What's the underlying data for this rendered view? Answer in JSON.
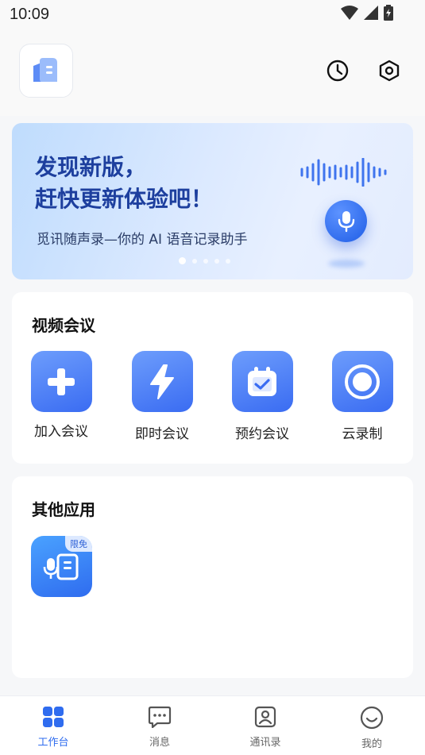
{
  "status_bar": {
    "time": "10:09"
  },
  "header": {
    "logo_icon": "app-logo-icon",
    "history_icon": "clock-icon",
    "settings_icon": "settings-hexagon-icon"
  },
  "banner": {
    "title": "发现新版，\n赶快更新体验吧！",
    "subtitle": "觅讯随声录—你的 AI 语音记录助手",
    "pages": 5,
    "active_page": 1
  },
  "video_meeting": {
    "title": "视频会议",
    "items": [
      {
        "label": "加入会议",
        "icon": "plus-icon"
      },
      {
        "label": "即时会议",
        "icon": "lightning-icon"
      },
      {
        "label": "预约会议",
        "icon": "calendar-check-icon"
      },
      {
        "label": "云录制",
        "icon": "record-icon"
      }
    ]
  },
  "other_apps": {
    "title": "其他应用",
    "apps": [
      {
        "badge": "限免",
        "icon": "voice-recorder-icon"
      }
    ]
  },
  "tabs": [
    {
      "label": "工作台",
      "icon": "grid-icon",
      "active": true
    },
    {
      "label": "消息",
      "icon": "message-icon",
      "active": false
    },
    {
      "label": "通讯录",
      "icon": "contacts-icon",
      "active": false
    },
    {
      "label": "我的",
      "icon": "smile-icon",
      "active": false
    }
  ],
  "colors": {
    "accent": "#2f6cef",
    "banner_title": "#1d3f9e"
  }
}
